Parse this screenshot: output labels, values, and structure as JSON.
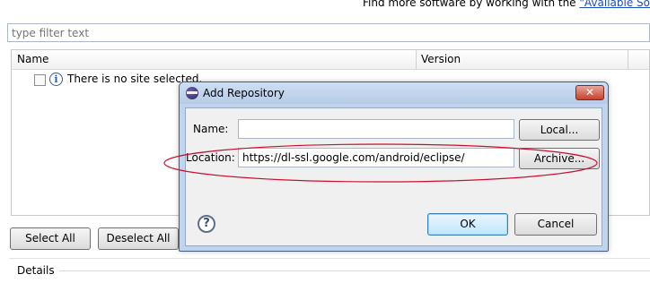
{
  "top_hint": {
    "prefix": "Find more software by working with the ",
    "link": "\"Available Softw"
  },
  "filter": {
    "placeholder": "type filter text"
  },
  "table": {
    "columns": [
      "Name",
      "Version"
    ],
    "row_message": "There is no site selected."
  },
  "buttons": {
    "select_all": "Select All",
    "deselect_all": "Deselect All"
  },
  "details": {
    "label": "Details"
  },
  "dialog": {
    "title": "Add Repository",
    "close_glyph": "✕",
    "name_label": "Name:",
    "name_value": "",
    "local_button": "Local...",
    "location_label": "Location:",
    "location_value": "https://dl-ssl.google.com/android/eclipse/",
    "archive_button": "Archive...",
    "help_glyph": "?",
    "ok_button": "OK",
    "cancel_button": "Cancel"
  },
  "icons": {
    "info": "info-icon",
    "help": "help-icon",
    "eclipse": "eclipse-icon",
    "close": "close-icon"
  },
  "colors": {
    "annotation": "#c8102e",
    "link": "#1a4bbf",
    "dialog_frame": "#bfd4ee"
  }
}
